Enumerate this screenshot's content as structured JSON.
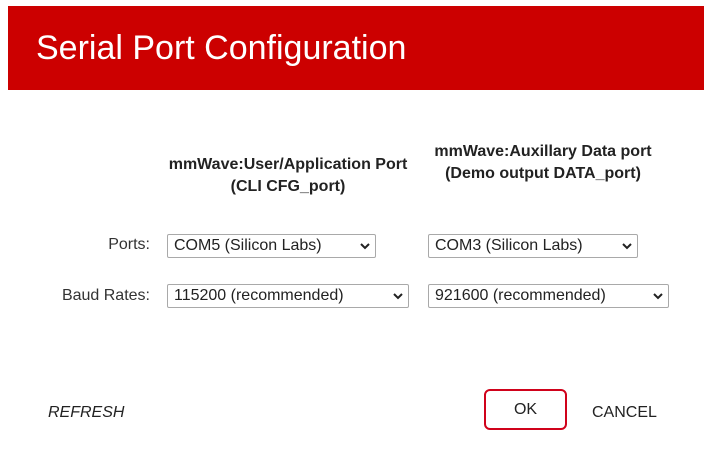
{
  "dialog": {
    "title": "Serial Port Configuration",
    "header_color": "#cc0000"
  },
  "columns": {
    "user_port_heading": "mmWave:User/Application Port (CLI CFG_port)",
    "data_port_heading": "mmWave:Auxillary Data port (Demo output DATA_port)"
  },
  "rows": {
    "ports_label": "Ports:",
    "baud_label": "Baud Rates:"
  },
  "selects": {
    "user_port": "COM5 (Silicon Labs)",
    "data_port": "COM3 (Silicon Labs)",
    "user_baud": "115200 (recommended)",
    "data_baud": "921600 (recommended)"
  },
  "buttons": {
    "refresh": "REFRESH",
    "ok": "OK",
    "cancel": "CANCEL",
    "ok_border_color": "#d0021b"
  },
  "icons": {
    "dropdown": "chevron-down-icon"
  }
}
